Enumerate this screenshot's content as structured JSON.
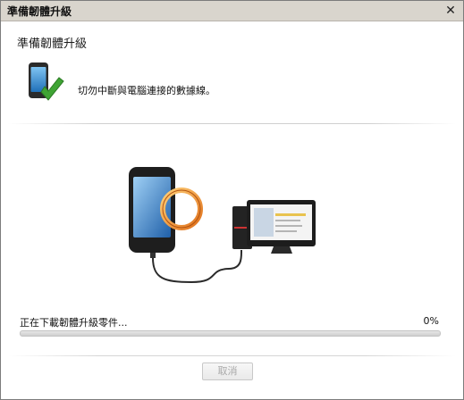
{
  "window": {
    "title": "準備韌體升級",
    "close_symbol": "✕"
  },
  "dialog": {
    "heading": "準備韌體升級",
    "instruction": "切勿中斷與電腦連接的數據線。",
    "status_icon": "phone-check-icon"
  },
  "progress": {
    "label": "正在下載韌體升級零件...",
    "percent_text": "0%",
    "value": 0
  },
  "buttons": {
    "cancel": "取消",
    "cancel_enabled": false
  },
  "colors": {
    "accent_green": "#3b9b2c",
    "ring_orange": "#f08a24"
  }
}
